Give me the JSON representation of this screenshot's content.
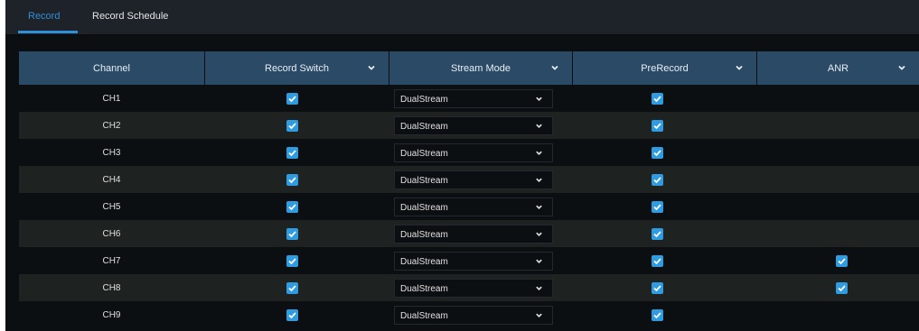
{
  "tabs": [
    {
      "label": "Record",
      "active": true
    },
    {
      "label": "Record Schedule",
      "active": false
    }
  ],
  "table": {
    "columns": [
      {
        "label": "Channel",
        "has_dropdown": false
      },
      {
        "label": "Record Switch",
        "has_dropdown": true
      },
      {
        "label": "Stream Mode",
        "has_dropdown": true
      },
      {
        "label": "PreRecord",
        "has_dropdown": true
      },
      {
        "label": "ANR",
        "has_dropdown": true
      }
    ],
    "rows": [
      {
        "channel": "CH1",
        "record_switch": true,
        "stream_mode": "DualStream",
        "prerecord": true,
        "anr": false
      },
      {
        "channel": "CH2",
        "record_switch": true,
        "stream_mode": "DualStream",
        "prerecord": true,
        "anr": false
      },
      {
        "channel": "CH3",
        "record_switch": true,
        "stream_mode": "DualStream",
        "prerecord": true,
        "anr": false
      },
      {
        "channel": "CH4",
        "record_switch": true,
        "stream_mode": "DualStream",
        "prerecord": true,
        "anr": false
      },
      {
        "channel": "CH5",
        "record_switch": true,
        "stream_mode": "DualStream",
        "prerecord": true,
        "anr": false
      },
      {
        "channel": "CH6",
        "record_switch": true,
        "stream_mode": "DualStream",
        "prerecord": true,
        "anr": false
      },
      {
        "channel": "CH7",
        "record_switch": true,
        "stream_mode": "DualStream",
        "prerecord": true,
        "anr": true
      },
      {
        "channel": "CH8",
        "record_switch": true,
        "stream_mode": "DualStream",
        "prerecord": true,
        "anr": true
      },
      {
        "channel": "CH9",
        "record_switch": true,
        "stream_mode": "DualStream",
        "prerecord": true,
        "anr": false
      }
    ]
  },
  "colors": {
    "accent": "#2f8fd8",
    "header_bg": "#2b4a66",
    "checkbox": "#2f9be0",
    "row_alt": "#1e2220",
    "background": "#0c0f12"
  }
}
